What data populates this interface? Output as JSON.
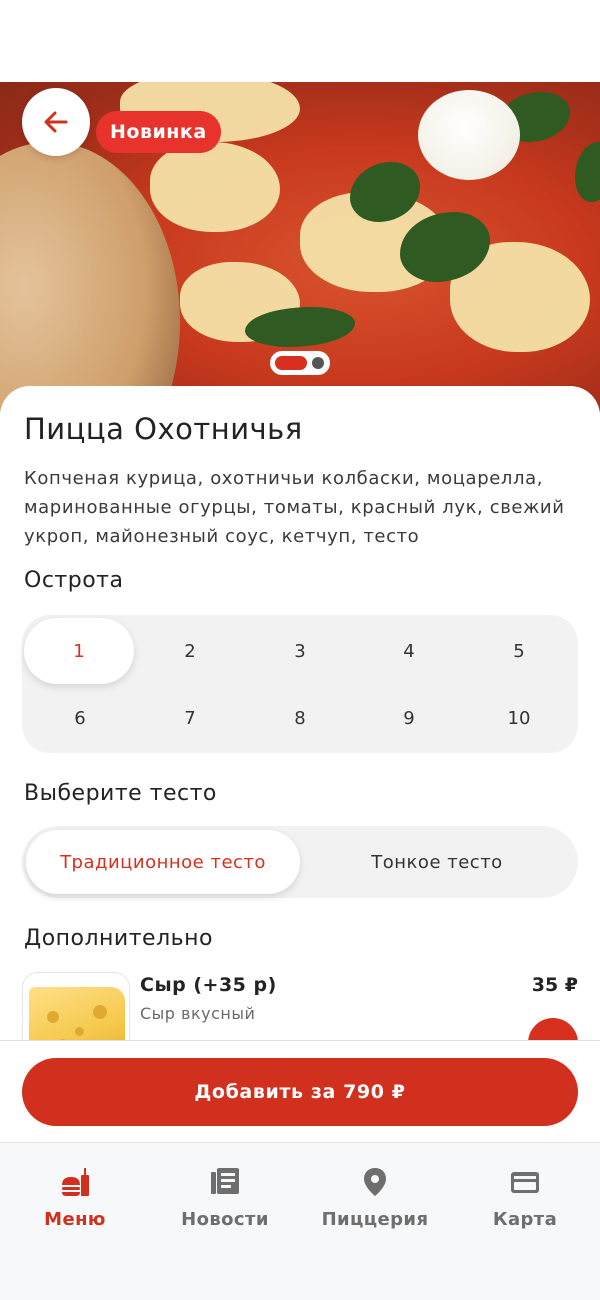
{
  "product": {
    "badge": "Новинка",
    "title": "Пицца Охотничья",
    "description": "Копченая курица, охотничьи колбаски, моцарелла, маринованные огурцы, томаты, красный лук, свежий укроп, майонезный соус, кетчуп, тесто",
    "carousel": {
      "pages": 2,
      "current": 1
    }
  },
  "spice": {
    "title": "Острота",
    "levels": [
      "1",
      "2",
      "3",
      "4",
      "5",
      "6",
      "7",
      "8",
      "9",
      "10"
    ],
    "selected": "1"
  },
  "dough": {
    "title": "Выберите тесто",
    "options": [
      "Традиционное тесто",
      "Тонкое тесто"
    ],
    "selected": "Традиционное тесто"
  },
  "extras": {
    "title": "Дополнительно",
    "items": [
      {
        "name": "Сыр (+35 р)",
        "subtitle": "Сыр вкусный",
        "price": "35 ₽",
        "icon": "cheese-image"
      }
    ]
  },
  "cta": {
    "label": "Добавить за 790 ₽"
  },
  "tabbar": {
    "items": [
      {
        "label": "Меню",
        "icon": "burger-drink-icon",
        "active": true
      },
      {
        "label": "Новости",
        "icon": "news-icon",
        "active": false
      },
      {
        "label": "Пиццерия",
        "icon": "location-pin-icon",
        "active": false
      },
      {
        "label": "Карта",
        "icon": "card-icon",
        "active": false
      }
    ]
  },
  "colors": {
    "accent": "#d0301d",
    "badge": "#e8322c",
    "inactive": "#6e6e6e",
    "segment_bg": "#f2f2f2"
  }
}
